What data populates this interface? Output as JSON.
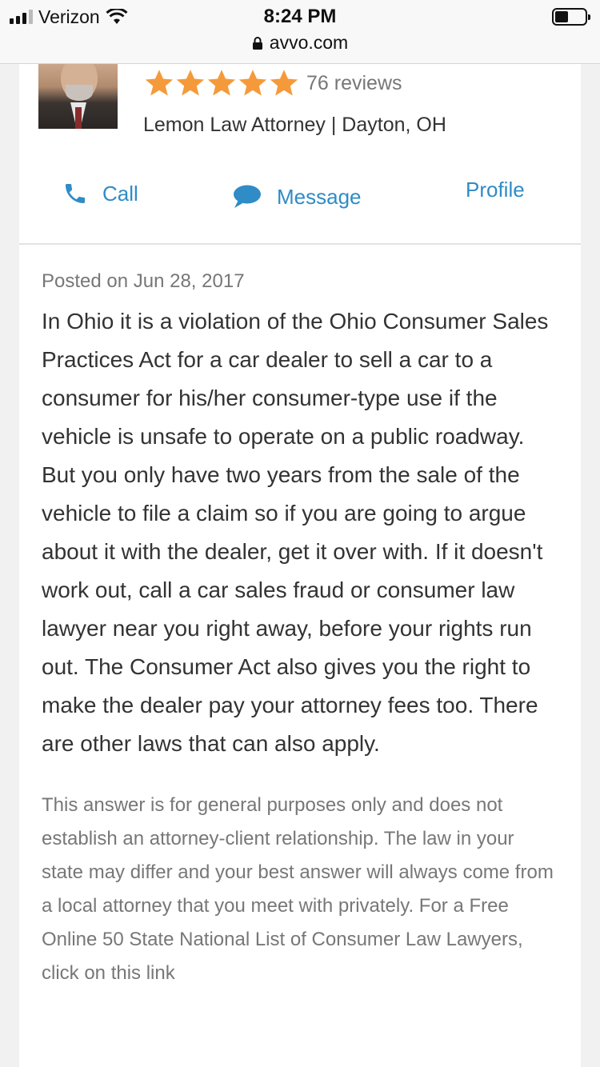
{
  "status_bar": {
    "carrier": "Verizon",
    "time": "8:24 PM",
    "url": "avvo.com",
    "battery_level": 0.45
  },
  "attorney": {
    "rating": 5,
    "reviews": "76 reviews",
    "subtitle": "Lemon Law Attorney | Dayton, OH",
    "star_color": "#f59a3b"
  },
  "actions": {
    "call": "Call",
    "message": "Message",
    "profile": "Profile",
    "accent": "#2f8cc6"
  },
  "answer": {
    "posted": "Posted on Jun 28, 2017",
    "body": "In Ohio it is a violation of the Ohio Consumer Sales Practices Act for a car dealer to sell a car to a consumer for his/her consumer-type use if the vehicle is unsafe to operate on a public roadway. But you only have two years from the sale of the vehicle to file a claim so if you are going to argue about it with the dealer, get it over with. If it doesn't work out, call a car sales fraud or consumer law lawyer near you right away, before your rights run out. The Consumer Act also gives you the right to make the dealer pay your attorney fees too. There are other laws that can also apply.",
    "disclaimer": "This answer is for general purposes only and does not establish an attorney-client relationship. The law in your state may differ and your best answer will always come from a local attorney that you meet with privately. For a Free Online 50 State National List of Consumer Law Lawyers, click on this link"
  }
}
